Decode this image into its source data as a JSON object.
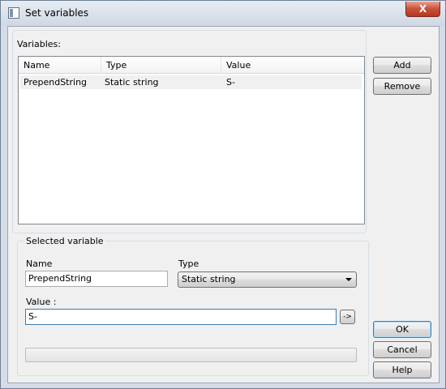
{
  "window": {
    "title": "Set variables",
    "close_glyph": "X"
  },
  "variables": {
    "label": "Variables:",
    "columns": [
      "Name",
      "Type",
      "Value"
    ],
    "rows": [
      {
        "name": "PrependString",
        "type": "Static string",
        "value": "S-"
      }
    ]
  },
  "side_buttons": {
    "add": "Add",
    "remove": "Remove"
  },
  "selected": {
    "legend": "Selected variable",
    "name_label": "Name",
    "name_value": "PrependString",
    "type_label": "Type",
    "type_value": "Static string",
    "value_label": "Value :",
    "value_value": "S-",
    "browse_glyph": "->"
  },
  "dialog_buttons": {
    "ok": "OK",
    "cancel": "Cancel",
    "help": "Help"
  },
  "colors": {
    "accent_border": "#3c7fb1",
    "close_red": "#c9503a",
    "selected_row": "#f0f0f0"
  }
}
